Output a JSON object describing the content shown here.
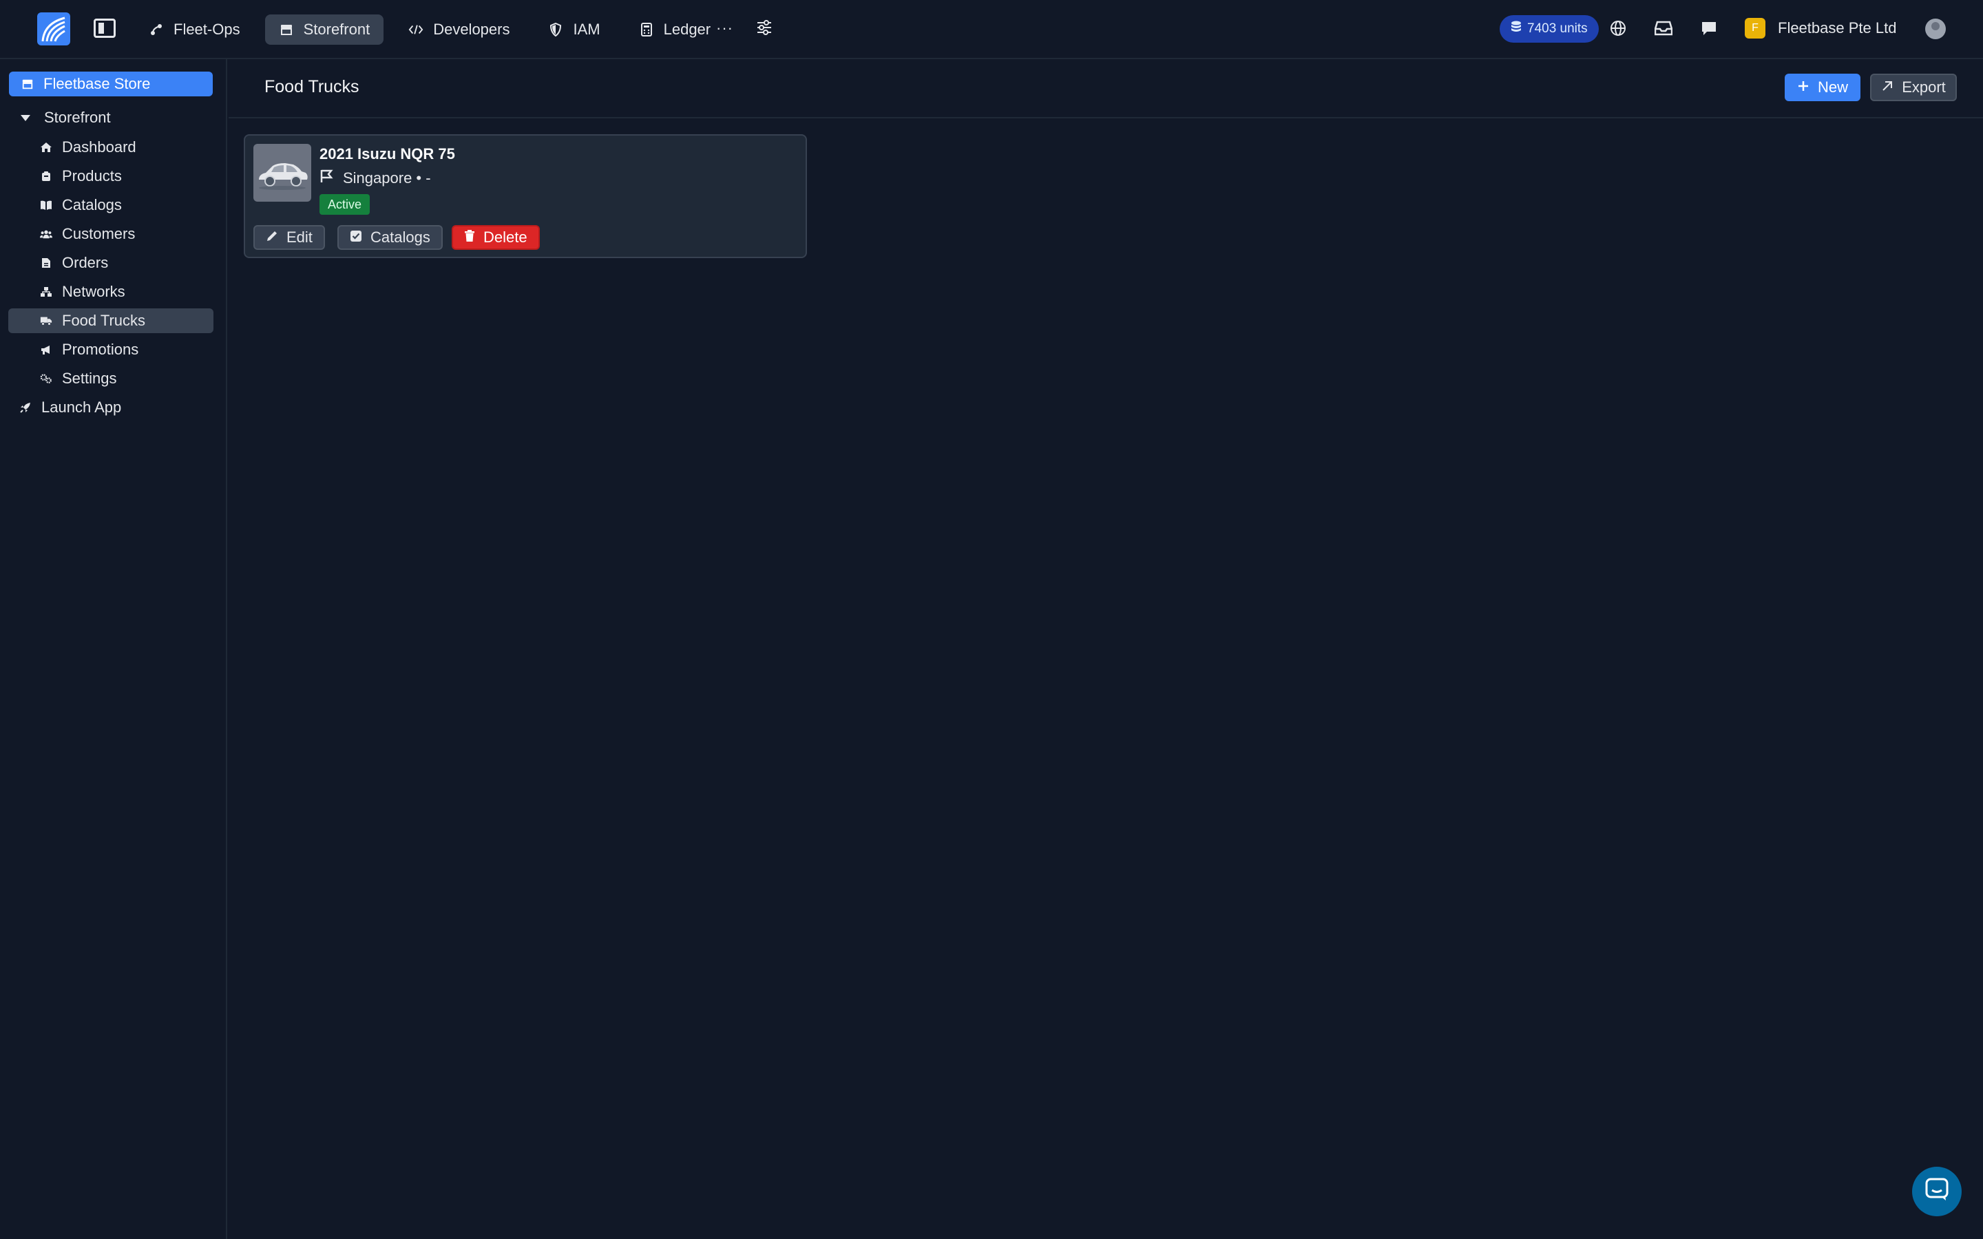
{
  "topbar": {
    "nav": [
      {
        "label": "Fleet-Ops",
        "icon": "route-icon"
      },
      {
        "label": "Storefront",
        "icon": "store-icon",
        "active": true
      },
      {
        "label": "Developers",
        "icon": "code-icon"
      },
      {
        "label": "IAM",
        "icon": "shield-icon"
      },
      {
        "label": "Ledger",
        "icon": "calculator-icon"
      }
    ],
    "more_label": "···",
    "credits": "7403 units",
    "org_initial": "F",
    "org_name": "Fleetbase Pte Ltd"
  },
  "sidebar": {
    "store_button": "Fleetbase Store",
    "group_label": "Storefront",
    "items": [
      {
        "label": "Dashboard",
        "icon": "home-icon"
      },
      {
        "label": "Products",
        "icon": "box-icon"
      },
      {
        "label": "Catalogs",
        "icon": "book-icon"
      },
      {
        "label": "Customers",
        "icon": "users-icon"
      },
      {
        "label": "Orders",
        "icon": "file-icon"
      },
      {
        "label": "Networks",
        "icon": "network-icon"
      },
      {
        "label": "Food Trucks",
        "icon": "truck-icon",
        "active": true
      },
      {
        "label": "Promotions",
        "icon": "megaphone-icon"
      },
      {
        "label": "Settings",
        "icon": "gears-icon"
      }
    ],
    "launch_label": "Launch App"
  },
  "main": {
    "title": "Food Trucks",
    "new_button": "New",
    "export_button": "Export",
    "card": {
      "title": "2021 Isuzu NQR 75",
      "location": "Singapore • -",
      "status": "Active",
      "edit_label": "Edit",
      "catalogs_label": "Catalogs",
      "delete_label": "Delete"
    }
  },
  "colors": {
    "background": "#111827",
    "accent": "#3b82f6",
    "danger": "#dc2626",
    "success": "#15803d",
    "credits_badge": "#1e40af"
  }
}
